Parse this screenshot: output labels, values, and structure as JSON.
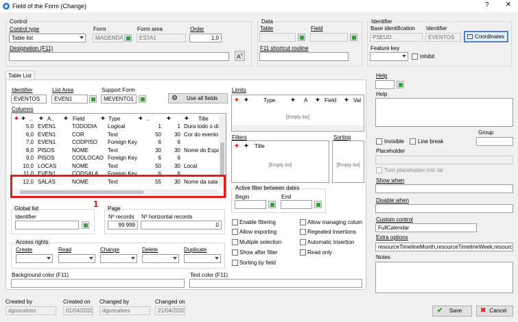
{
  "title": "Field of the Form (Change)",
  "title_help": "?",
  "title_close": "×",
  "control": {
    "group_label": "Control",
    "control_type_label": "Control type",
    "control_type_value": "Table list",
    "form_label": "Form",
    "form_value": "MAGENDA",
    "form_area_label": "Form area",
    "form_area_value": "ESTA1",
    "order_label": "Order",
    "order_value": "1,0",
    "designation_label": "Designation (F11)",
    "designation_value": ""
  },
  "data_group": {
    "group_label": "Data",
    "table_label": "Table",
    "field_label": "Field",
    "shortcut_label": "F11 shortcut routine"
  },
  "identifier_group": {
    "group_label": "Identifier",
    "base_label": "Base identification",
    "base_value": "PSEUD",
    "identifier_label": "Identifier",
    "identifier_value": "EVENTOS",
    "coordinates_label": "Coordinates",
    "feature_key_label": "Feature key",
    "inhibit_label": "Inhibit"
  },
  "tab_label": "Table List",
  "table_list": {
    "identifier_label": "Identifier",
    "identifier_value": "EVENTOS",
    "list_area_label": "List Area",
    "list_area_value": "EVEN1",
    "support_form_label": "Support Form",
    "support_form_value": "MEVENTO1",
    "use_all_fields_label": "Use all fields",
    "columns_label": "Columns",
    "columns_headers": [
      "..",
      "A..",
      "Field",
      "Type",
      "..",
      "Title"
    ],
    "columns_rows": [
      [
        "5,0",
        "EVEN1",
        "TODODIA",
        "Logical",
        "1",
        "1",
        "Dura todo o dia?"
      ],
      [
        "6,0",
        "EVEN1",
        "COR",
        "Text",
        "50",
        "30",
        "Cor do evento"
      ],
      [
        "7,0",
        "EVEN1",
        "CODPISO",
        "Foreign Key",
        "6",
        "6",
        ""
      ],
      [
        "8,0",
        "PISOS",
        "NOME",
        "Text",
        "30",
        "30",
        "Nome do Espaço"
      ],
      [
        "9,0",
        "PISOS",
        "CODLOCAO",
        "Foreign Key",
        "6",
        "6",
        ""
      ],
      [
        "10,0",
        "LOCAS",
        "NOME",
        "Text",
        "50",
        "30",
        "Local"
      ],
      [
        "11,0",
        "EVEN1",
        "CODSALA",
        "Foreign Key",
        "6",
        "6",
        ""
      ],
      [
        "12,0",
        "SALAS",
        "NOME",
        "Text",
        "55",
        "30",
        "Nome da sala"
      ]
    ],
    "annotation": "1",
    "limits_label": "Limits",
    "limits_headers": [
      "Type",
      "A",
      "Field",
      "Val"
    ],
    "limits_empty": "[Empty list]",
    "filters_label": "Filters",
    "filters_headers": [
      "Title"
    ],
    "filters_empty": "[Empty list]",
    "sorting_label": "Sorting",
    "sorting_empty": "[Empty list]",
    "active_filter_label": "Active filter between dates",
    "begin_label": "Begin",
    "end_label": "End",
    "global_list_label": "Global list",
    "gl_identifier_label": "Identifier",
    "page_label": "Page",
    "records_label": "Nº records",
    "records_value": "99 999",
    "horizontal_records_label": "Nº horizontal records",
    "horizontal_records_value": "0",
    "checks": {
      "enable_filtering": "Enable filtering",
      "allow_exporting": "Allow exporting",
      "multiple_selection": "Multiple selection",
      "show_after_filter": "Show after filter",
      "sorting_by_field": "Sorting by field",
      "allow_managing_columns": "Allow managing colum",
      "regeated_insertions": "Regeated insertions",
      "automatic_insertion": "Automatic Insertion",
      "read_only": "Read only"
    },
    "access_rights_label": "Access rights",
    "access": [
      "Create",
      "Read",
      "Change",
      "Delete",
      "Duplicate"
    ],
    "background_color_label": "Background color (F11)",
    "text_color_label": "Text color (F11)"
  },
  "right": {
    "help_label": "Help",
    "help2_label": "Help",
    "invisible_label": "Invisible",
    "line_break_label": "Line break",
    "group_label": "Group",
    "placeholder_label": "Placeholder",
    "turn_placeholder_label": "Turn placeholder into lat",
    "show_when_label": "Show when",
    "disable_when_label": "Disable when",
    "custom_control_label": "Custom control",
    "custom_control_value": "FullCalendar",
    "extra_options_label": "Extra options",
    "extra_options_value": "resourceTimelineMonth,resourceTimelineWeek,resourceTi",
    "notes_label": "Notes"
  },
  "footer": {
    "created_by_label": "Created by",
    "created_by_value": "dgoncalves",
    "created_on_label": "Created on",
    "created_on_value": "01/04/2020",
    "changed_by_label": "Changed by",
    "changed_by_value": "dgoncalves",
    "changed_on_label": "Changed on",
    "changed_on_value": "21/04/2020",
    "save_label": "Save",
    "cancel_label": "Cancel"
  }
}
